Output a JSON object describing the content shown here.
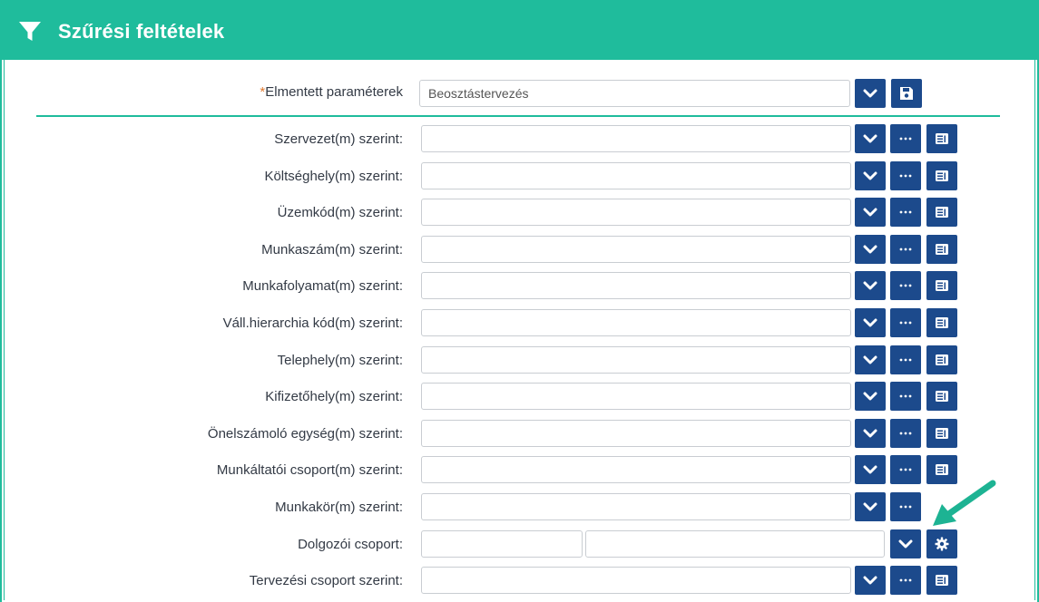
{
  "header": {
    "title": "Szűrési feltételek",
    "icon": "filter-icon"
  },
  "saved_params": {
    "required_mark": "*",
    "label": "Elmentett paraméterek",
    "value": "Beosztástervezés",
    "buttons": [
      "chevron-down-icon",
      "save-icon"
    ]
  },
  "rows": [
    {
      "label": "Szervezet(m) szerint:",
      "value": ""
    },
    {
      "label": "Költséghely(m) szerint:",
      "value": ""
    },
    {
      "label": "Üzemkód(m) szerint:",
      "value": ""
    },
    {
      "label": "Munkaszám(m) szerint:",
      "value": ""
    },
    {
      "label": "Munkafolyamat(m) szerint:",
      "value": ""
    },
    {
      "label": "Váll.hierarchia kód(m) szerint:",
      "value": ""
    },
    {
      "label": "Telephely(m) szerint:",
      "value": ""
    },
    {
      "label": "Kifizetőhely(m) szerint:",
      "value": ""
    },
    {
      "label": "Önelszámoló egység(m) szerint:",
      "value": ""
    },
    {
      "label": "Munkáltatói csoport(m) szerint:",
      "value": ""
    },
    {
      "label": "Munkakör(m) szerint:",
      "value": ""
    },
    {
      "label": "Dolgozói csoport:",
      "value": "",
      "value2": ""
    },
    {
      "label": "Tervezési csoport szerint:",
      "value": ""
    }
  ],
  "colors": {
    "accent": "#1fbc9c",
    "button": "#1c4a8c"
  }
}
